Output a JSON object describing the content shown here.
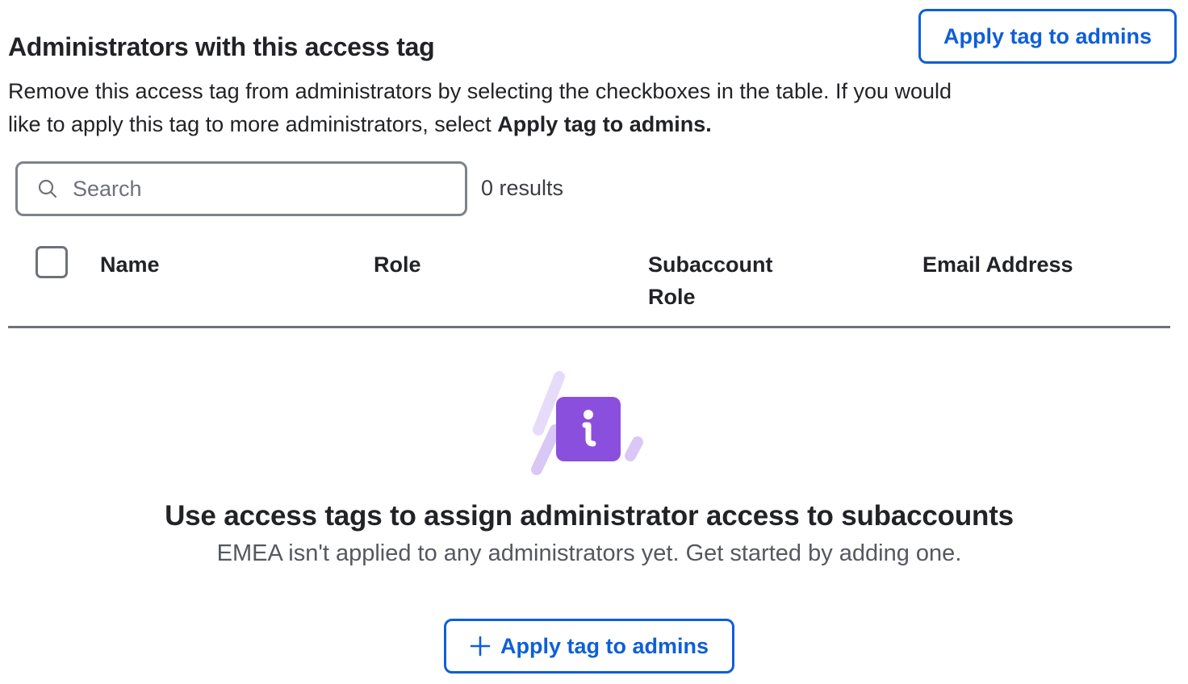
{
  "section": {
    "title": "Administrators with this access tag",
    "apply_button_label": "Apply tag to admins",
    "description_text": "Remove this access tag from administrators by selecting the checkboxes in the table. If you would like to apply this tag to more administrators, select ",
    "description_bold": "Apply tag to admins."
  },
  "search": {
    "placeholder": "Search",
    "value": "",
    "results_text": "0 results",
    "icon": "search-icon"
  },
  "table": {
    "columns": [
      "Name",
      "Role",
      "Subaccount Role",
      "Email Address"
    ],
    "select_all_checked": false,
    "rows": []
  },
  "empty_state": {
    "icon": "info-icon",
    "title": "Use access tags to assign administrator access to subaccounts",
    "subtitle": "EMEA isn't applied to any administrators yet. Get started by adding one.",
    "button_label": "Apply tag to admins",
    "button_icon": "plus-icon"
  },
  "colors": {
    "accent": "#0e5fd8",
    "illustration_purple": "#8b4fde",
    "illustration_light": "#d9c7f5"
  }
}
